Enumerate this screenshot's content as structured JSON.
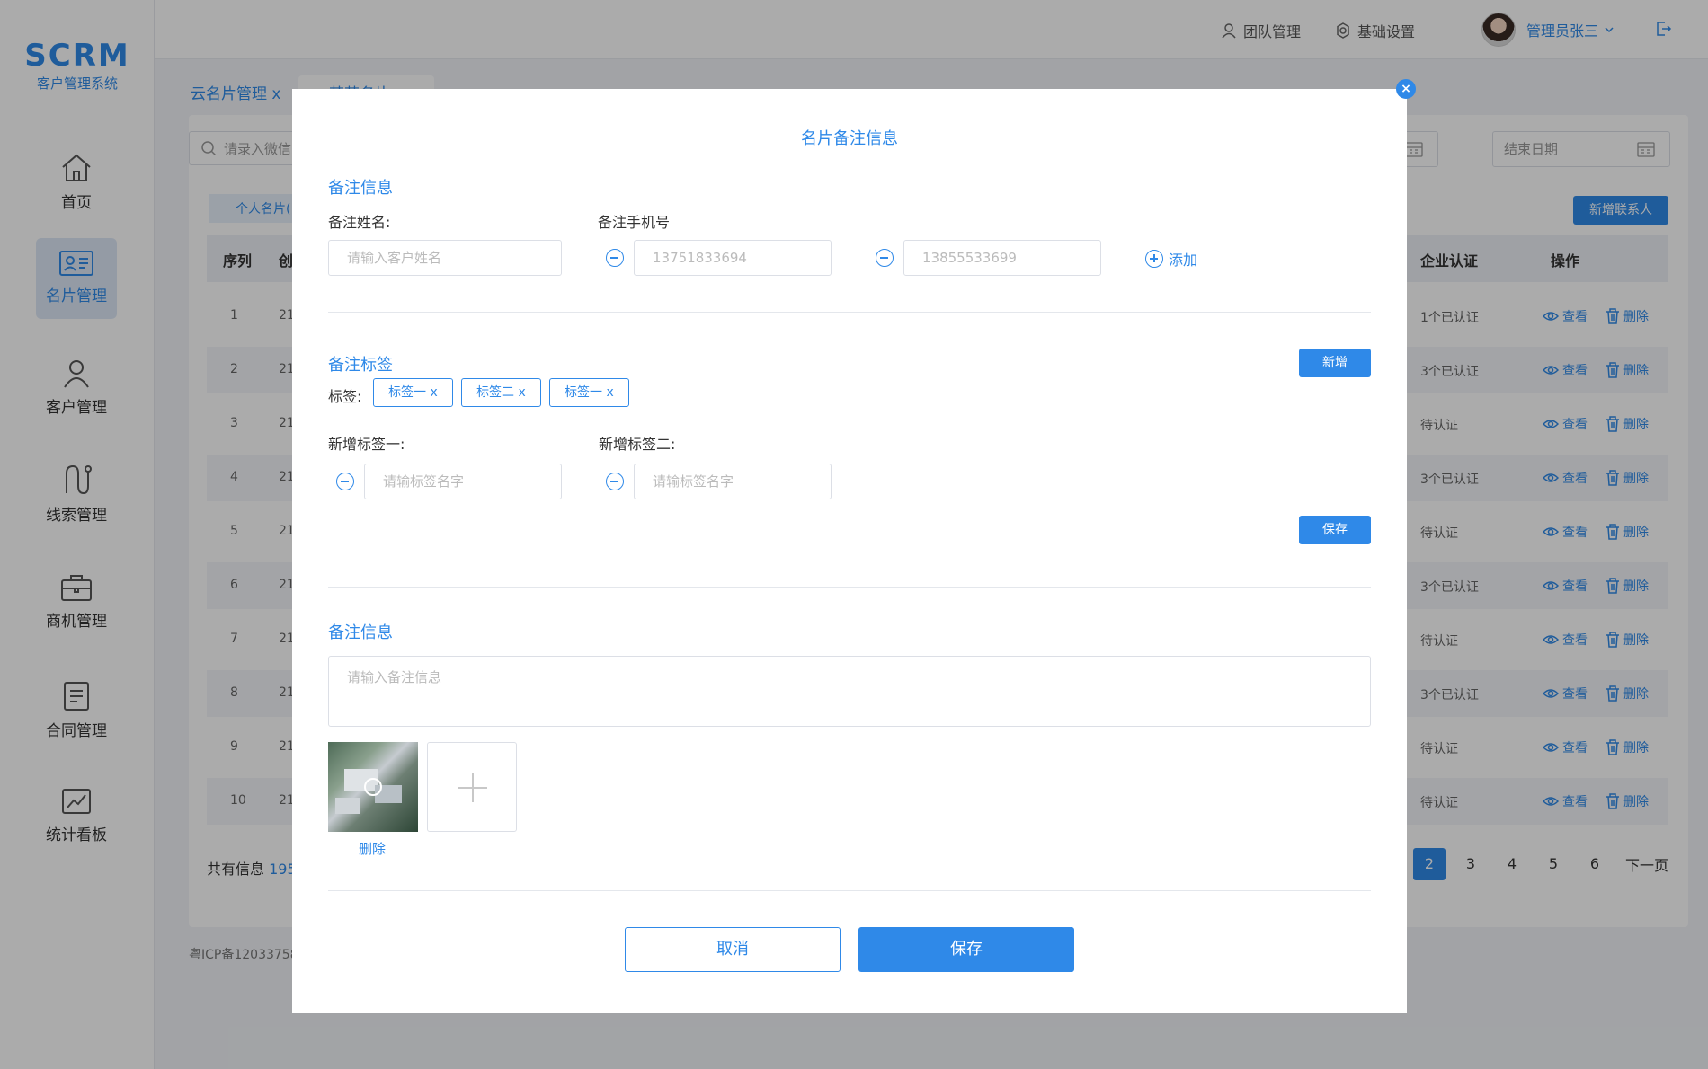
{
  "brand": {
    "logo": "SCRM",
    "subtitle": "客户管理系统",
    "accent": "#2f89e8"
  },
  "sidebar": {
    "items": [
      {
        "label": "首页",
        "icon": "home-icon"
      },
      {
        "label": "名片管理",
        "icon": "id-card-icon",
        "active": true
      },
      {
        "label": "客户管理",
        "icon": "user-icon"
      },
      {
        "label": "线索管理",
        "icon": "route-icon"
      },
      {
        "label": "商机管理",
        "icon": "briefcase-icon"
      },
      {
        "label": "合同管理",
        "icon": "document-icon"
      },
      {
        "label": "统计看板",
        "icon": "chart-icon"
      }
    ]
  },
  "header": {
    "team": "团队管理",
    "settings": "基础设置",
    "user": "管理员张三"
  },
  "tabs": [
    {
      "label": "云名片管理",
      "close": "x"
    },
    {
      "label": "芸芸名片",
      "close": "x"
    }
  ],
  "content": {
    "search_placeholder": "请录入微信",
    "end_date": "结束日期",
    "sub_tab": "个人名片(",
    "new_contact": "新增联系人",
    "headers": {
      "index": "序列",
      "created": "创",
      "auth": "企业认证",
      "ops": "操作"
    },
    "rows": [
      {
        "idx": "1",
        "c": "21",
        "auth": "1个已认证"
      },
      {
        "idx": "2",
        "c": "21",
        "auth": "3个已认证"
      },
      {
        "idx": "3",
        "c": "21",
        "auth": "待认证"
      },
      {
        "idx": "4",
        "c": "21",
        "auth": "3个已认证"
      },
      {
        "idx": "5",
        "c": "21",
        "auth": "待认证"
      },
      {
        "idx": "6",
        "c": "21",
        "auth": "3个已认证"
      },
      {
        "idx": "7",
        "c": "21",
        "auth": "待认证"
      },
      {
        "idx": "8",
        "c": "21",
        "auth": "3个已认证"
      },
      {
        "idx": "9",
        "c": "21",
        "auth": "待认证"
      },
      {
        "idx": "10",
        "c": "21",
        "auth": "待认证"
      }
    ],
    "view": "查看",
    "delete": "删除",
    "total_label": "共有信息",
    "total_value": "195",
    "pages": [
      "2",
      "3",
      "4",
      "5",
      "6"
    ],
    "next": "下一页",
    "icp": "粤ICP备12033758"
  },
  "modal": {
    "title": "名片备注信息",
    "close": "×",
    "section1": "备注信息",
    "name_label": "备注姓名:",
    "name_placeholder": "请输入客户姓名",
    "phone_label": "备注手机号",
    "phone1": "13751833694",
    "phone2": "13855533699",
    "add": "添加",
    "section2": "备注标签",
    "new_btn": "新增",
    "tags_label": "标签:",
    "tags": [
      {
        "text": "标签一",
        "close": "x"
      },
      {
        "text": "标签二",
        "close": "x"
      },
      {
        "text": "标签一",
        "close": "x"
      }
    ],
    "new_tag1_label": "新增标签一:",
    "new_tag2_label": "新增标签二:",
    "tag_placeholder": "请输标签名字",
    "save_small": "保存",
    "section3": "备注信息",
    "note_placeholder": "请输入备注信息",
    "image_delete": "删除",
    "cancel": "取消",
    "save": "保存"
  }
}
